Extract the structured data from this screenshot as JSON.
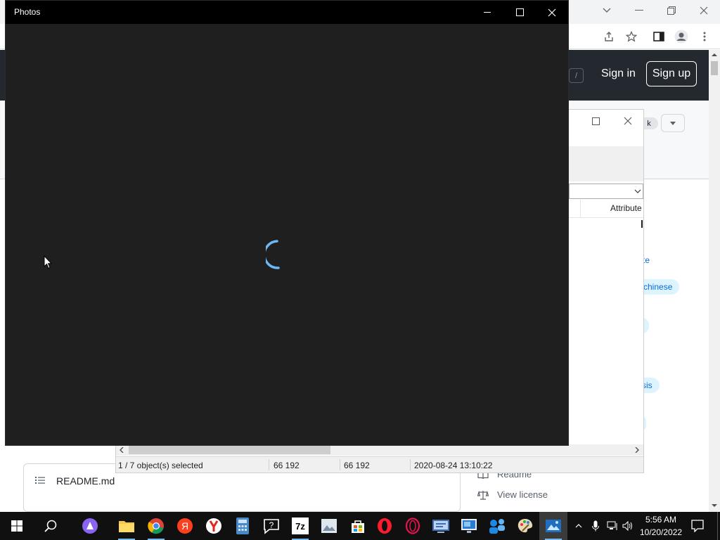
{
  "photos": {
    "title": "Photos"
  },
  "github": {
    "search_slash": "/",
    "sign_in": "Sign in",
    "sign_up": "Sign up",
    "fork_count_fragment": "k",
    "topic_fragments": [
      "chinese",
      "sis"
    ],
    "link_fragment": "te",
    "readme_filename": "README.md",
    "sidebar_readme": "Readme",
    "sidebar_license": "View license"
  },
  "sevenzip": {
    "column_header": "Attribute",
    "status": {
      "selection": "1 / 7 object(s) selected",
      "size": "66 192",
      "packed_size": "66 192",
      "modified": "2020-08-24 13:10:22"
    }
  },
  "taskbar": {
    "icons": [
      "windows-start-icon",
      "search-icon",
      "alice-icon",
      "file-explorer-icon",
      "chrome-icon",
      "yandex-icon",
      "yandex-browser-icon",
      "calculator-icon",
      "help-icon",
      "7zip-icon",
      "image-viewer-icon",
      "store-icon",
      "opera-icon",
      "opera-gx-icon",
      "network-tool-icon",
      "remote-desktop-icon",
      "people-icon",
      "paint-icon",
      "photos-icon"
    ],
    "time": "5:56 AM",
    "date": "10/20/2022"
  }
}
